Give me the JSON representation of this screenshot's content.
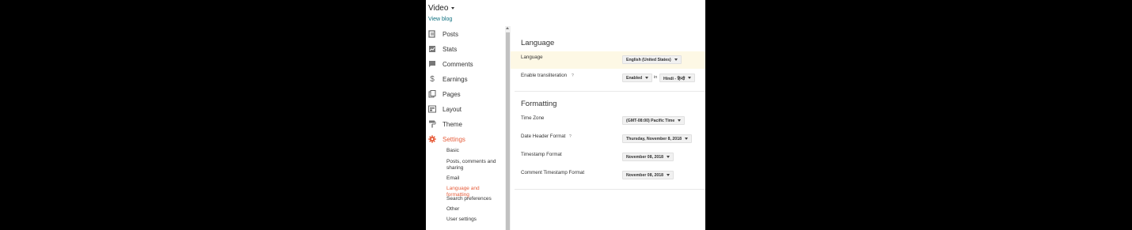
{
  "header": {
    "blog_name": "Video",
    "view_blog": "View blog"
  },
  "sidebar": {
    "items": [
      {
        "label": "Posts",
        "icon": "posts-icon"
      },
      {
        "label": "Stats",
        "icon": "stats-icon"
      },
      {
        "label": "Comments",
        "icon": "comments-icon"
      },
      {
        "label": "Earnings",
        "icon": "dollar-icon"
      },
      {
        "label": "Pages",
        "icon": "pages-icon"
      },
      {
        "label": "Layout",
        "icon": "layout-icon"
      },
      {
        "label": "Theme",
        "icon": "theme-icon"
      },
      {
        "label": "Settings",
        "icon": "gear-icon",
        "active": true
      }
    ],
    "settings_sub": [
      {
        "label": "Basic"
      },
      {
        "label": "Posts, comments and sharing"
      },
      {
        "label": "Email"
      },
      {
        "label": "Language and formatting",
        "active": true
      },
      {
        "label": "Search preferences"
      },
      {
        "label": "Other"
      },
      {
        "label": "User settings"
      }
    ]
  },
  "main": {
    "language_section": {
      "title": "Language",
      "language_label": "Language",
      "language_value": "English (United States)",
      "transliteration_label": "Enable transliteration",
      "help": "?",
      "transliteration_value": "Enabled",
      "in_word": "in",
      "transliteration_language": "Hindi - हिन्दी"
    },
    "formatting_section": {
      "title": "Formatting",
      "timezone_label": "Time Zone",
      "timezone_value": "(GMT-08:00) Pacific Time",
      "date_header_label": "Date Header Format",
      "help": "?",
      "date_header_value": "Thursday, November 8, 2018",
      "timestamp_label": "Timestamp Format",
      "timestamp_value": "November 08, 2018",
      "comment_timestamp_label": "Comment Timestamp Format",
      "comment_timestamp_value": "November 08, 2018"
    }
  },
  "colors": {
    "accent": "#e65c3a",
    "highlight": "#fdf8e5",
    "link": "#0b6e7e"
  }
}
